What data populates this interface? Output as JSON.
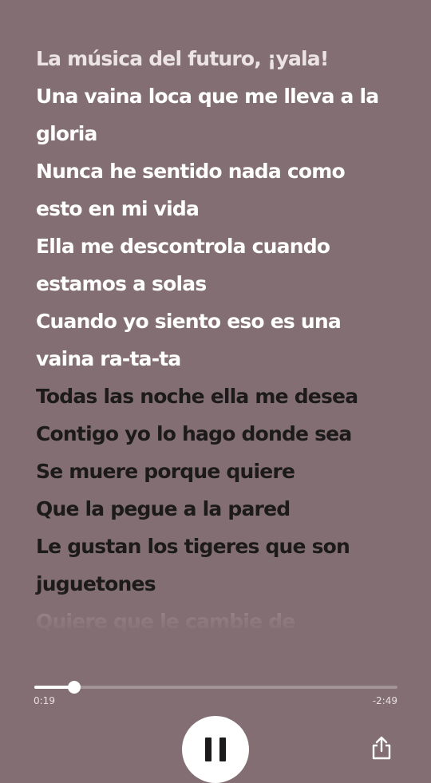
{
  "lyrics": {
    "lines": [
      {
        "text": "La música del futuro, ¡yala!",
        "state": "past"
      },
      {
        "text": "Una vaina loca que me lleva a la",
        "state": "current"
      },
      {
        "text": "gloria",
        "state": "current"
      },
      {
        "text": "Nunca he sentido nada como",
        "state": "current"
      },
      {
        "text": "esto en mi vida",
        "state": "current"
      },
      {
        "text": "Ella me descontrola cuando",
        "state": "current"
      },
      {
        "text": "estamos a solas",
        "state": "current"
      },
      {
        "text": "Cuando yo siento eso es una",
        "state": "current"
      },
      {
        "text": "vaina ra-ta-ta",
        "state": "current"
      },
      {
        "text": "Todas las noche ella me desea",
        "state": "upcoming"
      },
      {
        "text": "Contigo yo lo hago donde sea",
        "state": "upcoming"
      },
      {
        "text": "Se muere porque quiere",
        "state": "upcoming"
      },
      {
        "text": "Que la pegue a la pared",
        "state": "upcoming"
      },
      {
        "text": "Le gustan los tigeres que son",
        "state": "upcoming"
      },
      {
        "text": "juguetones",
        "state": "upcoming"
      },
      {
        "text": "Quiere que le cambie de",
        "state": "faded"
      }
    ]
  },
  "player": {
    "elapsed": "0:19",
    "remaining": "-2:49",
    "progress_fraction": 0.11,
    "play_state": "paused-icon",
    "play_icon": "pause-icon",
    "share_icon": "share-icon"
  },
  "colors": {
    "background": "#836f73",
    "lyric_active": "#ffffff",
    "lyric_upcoming": "#1c1a1b",
    "accent": "#ffffff"
  }
}
